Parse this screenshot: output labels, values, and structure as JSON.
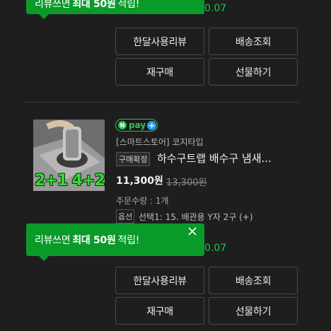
{
  "tooltip_top": {
    "prefix": "리뷰쓰면",
    "highlight": "최대 50원",
    "suffix": "적립!"
  },
  "point_top": "0.07",
  "order1": {
    "buttons": [
      "한달사용리뷰",
      "배송조회",
      "재구매",
      "선물하기"
    ]
  },
  "order2": {
    "npay_label": "pay",
    "npay_n": "N",
    "npay_plus": "+",
    "store": "[스마트스토어] 코지타입",
    "badge": "구매확정",
    "title": "하수구트랩 배수구 냄새...",
    "price": "11,300원",
    "original_price": "13,300원",
    "quantity": "주문수량 : 1개",
    "option_label": "옵션",
    "option_text": "선택1: 15. 배관용 Y자 2구 (+)",
    "thumb_text": "2+1 4+2",
    "tooltip": {
      "prefix": "리뷰쓰면",
      "highlight": "최대 50원",
      "suffix": "적립!"
    },
    "point": "0.07",
    "buttons": [
      "한달사용리뷰",
      "배송조회",
      "재구매",
      "선물하기"
    ]
  },
  "colors": {
    "background": "#1e1e1e",
    "tooltip_green": "#0a9a2a",
    "point_green": "#1dc74a",
    "npay_green": "#2ec25a"
  }
}
